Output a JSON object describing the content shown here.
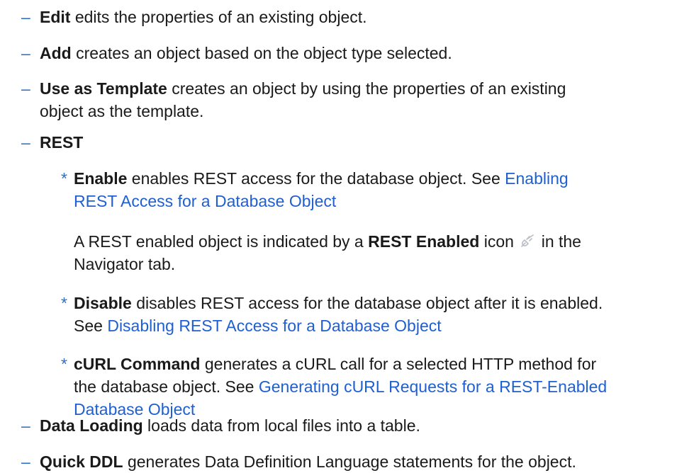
{
  "bullets": {
    "dash": "–",
    "star": "*"
  },
  "items": {
    "edit": {
      "term": "Edit",
      "desc": " edits the properties of an existing object."
    },
    "add": {
      "term": "Add",
      "desc": " creates an object based on the object type selected."
    },
    "template": {
      "term": "Use as Template",
      "desc1": " creates an object by using the properties of an existing",
      "desc2": "object as the template."
    },
    "rest": {
      "term": "REST",
      "enable": {
        "term": "Enable",
        "desc": " enables REST access for the database object. See ",
        "link1": "Enabling",
        "link2": "REST Access for a Database Object",
        "note_pre": "A REST enabled object is indicated by a ",
        "note_term": "REST Enabled",
        "note_mid": " icon ",
        "note_post": " in the",
        "note_line2": "Navigator tab."
      },
      "disable": {
        "term": "Disable",
        "desc": " disables REST access for the database object after it is enabled.",
        "see": "See ",
        "link": "Disabling REST Access for a Database Object"
      },
      "curl": {
        "term": "cURL Command",
        "desc1": " generates a cURL call for a selected HTTP method for",
        "desc2": "the database object. See ",
        "link1": "Generating cURL Requests for a REST-Enabled",
        "link2": "Database Object"
      }
    },
    "data_loading": {
      "term": "Data Loading",
      "desc": " loads data from local files into a table."
    },
    "quick_ddl": {
      "term": "Quick DDL",
      "desc": " generates Data Definition Language statements for the object."
    }
  },
  "icons": {
    "rest_enabled": "plug-icon"
  },
  "colors": {
    "link": "#1f5fd0",
    "bullet": "#2d6fc9",
    "text": "#1a1a1a"
  }
}
